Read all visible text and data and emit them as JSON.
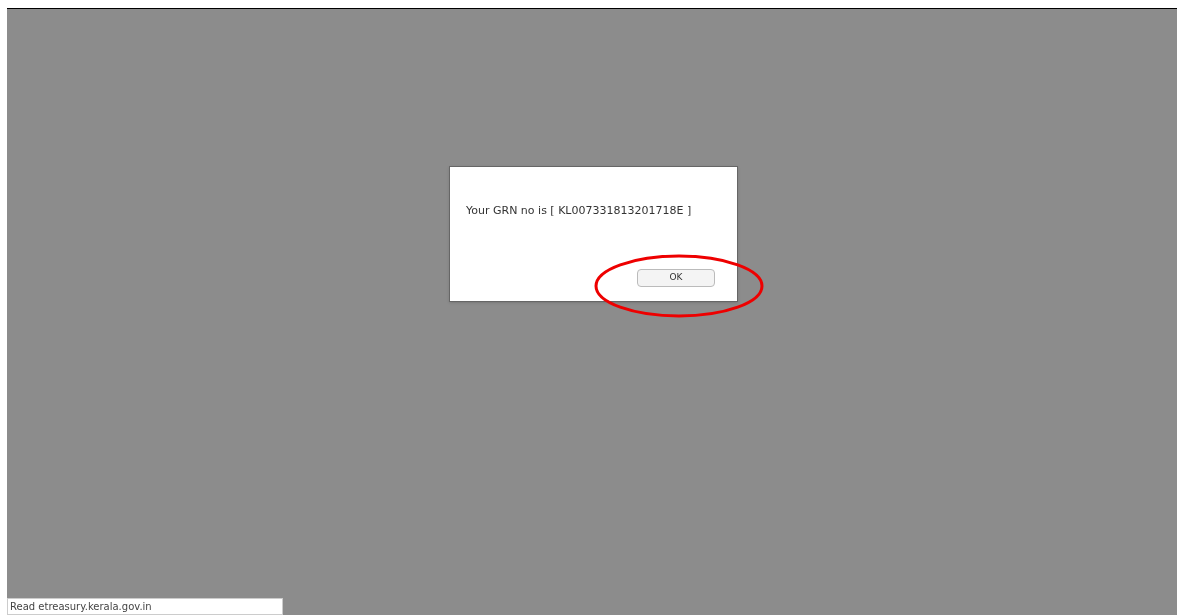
{
  "dialog": {
    "message": "Your GRN no is [ KL007331813201718E ]",
    "buttons": [
      "OK"
    ]
  },
  "status_bar": {
    "text": "Read etreasury.kerala.gov.in"
  },
  "annotation": {
    "kind": "ellipse",
    "color": "#ee0000"
  }
}
